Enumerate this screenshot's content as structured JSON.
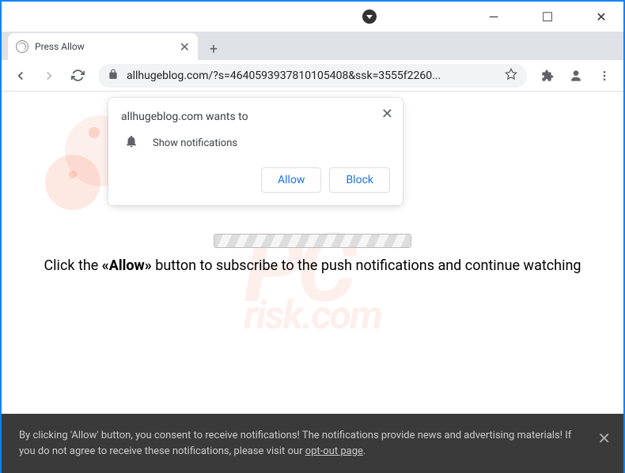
{
  "window": {
    "minimize": "—",
    "maximize": "☐",
    "close": "✕"
  },
  "tab": {
    "title": "Press Allow",
    "close": "✕",
    "newtab": "+"
  },
  "toolbar": {
    "url": "allhugeblog.com/?s=4640593937810105408&ssk=3555f2260..."
  },
  "permission": {
    "title": "allhugeblog.com wants to",
    "label": "Show notifications",
    "allow": "Allow",
    "block": "Block",
    "close": "✕"
  },
  "page": {
    "instruction_pre": "Click the ",
    "instruction_bold": "«Allow»",
    "instruction_post": " button to subscribe to the push notifications and continue watching"
  },
  "consent": {
    "text_pre": "By clicking 'Allow' button, you consent to receive notifications! The notifications provide news and advertising materials! If you do not agree to receive these notifications, please visit our ",
    "link": "opt-out page",
    "text_post": ".",
    "close": "✕"
  },
  "watermark": {
    "main": "PC",
    "sub": "risk.com"
  }
}
